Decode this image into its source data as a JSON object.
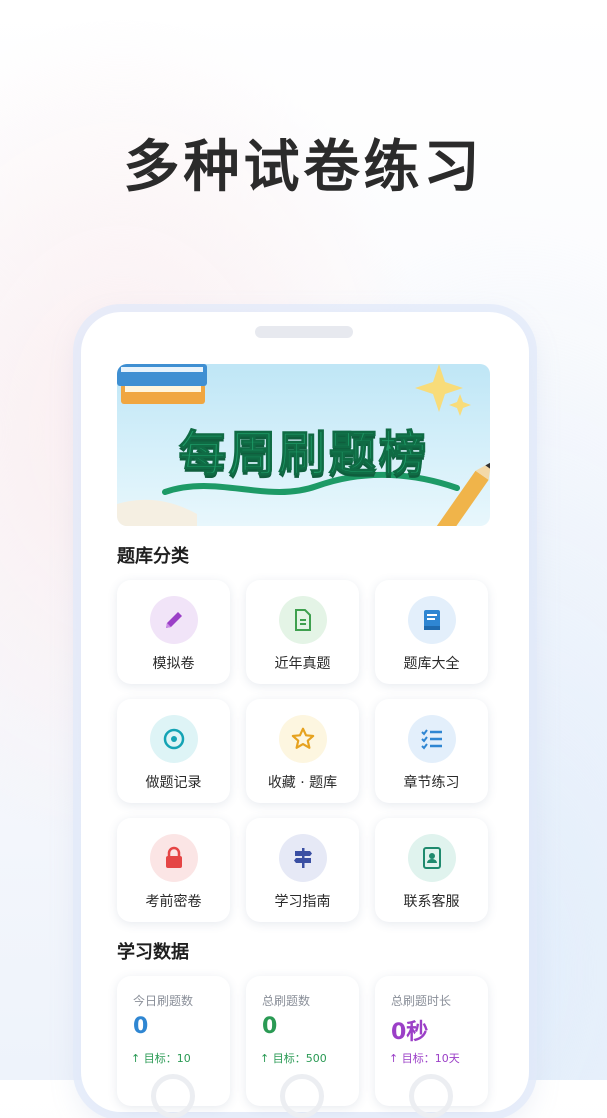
{
  "headline": "多种试卷练习",
  "banner": {
    "title": "每周刷题榜"
  },
  "categories": {
    "title": "题库分类",
    "items": [
      {
        "label": "模拟卷",
        "icon": "pencil-icon",
        "bg": "#f1e4f8",
        "fg": "#9b3fc7"
      },
      {
        "label": "近年真题",
        "icon": "document-icon",
        "bg": "#e4f4e6",
        "fg": "#3fa04f"
      },
      {
        "label": "题库大全",
        "icon": "book-icon",
        "bg": "#e3effb",
        "fg": "#2f86d2"
      },
      {
        "label": "做题记录",
        "icon": "disc-icon",
        "bg": "#def4f6",
        "fg": "#14a3b4"
      },
      {
        "label": "收藏 · 题库",
        "icon": "star-icon",
        "bg": "#fdf6e0",
        "fg": "#e6a21f"
      },
      {
        "label": "章节练习",
        "icon": "checklist-icon",
        "bg": "#e3effb",
        "fg": "#2f86d2"
      },
      {
        "label": "考前密卷",
        "icon": "lock-icon",
        "bg": "#fbe5e5",
        "fg": "#e54545"
      },
      {
        "label": "学习指南",
        "icon": "signpost-icon",
        "bg": "#e6e9f6",
        "fg": "#3a4fa3"
      },
      {
        "label": "联系客服",
        "icon": "contact-icon",
        "bg": "#e0f3ee",
        "fg": "#1f8a6e"
      }
    ]
  },
  "stats": {
    "title": "学习数据",
    "items": [
      {
        "label": "今日刷题数",
        "value": "0",
        "target": "↑ 目标：10",
        "color": "#2f86d2",
        "target_color": "#2a9a54"
      },
      {
        "label": "总刷题数",
        "value": "0",
        "target": "↑ 目标：500",
        "color": "#2a9a54",
        "target_color": "#2a9a54"
      },
      {
        "label": "总刷题时长",
        "value": "0秒",
        "target": "↑ 目标：10天",
        "color": "#9b3fc7",
        "target_color": "#9b3fc7"
      }
    ]
  }
}
